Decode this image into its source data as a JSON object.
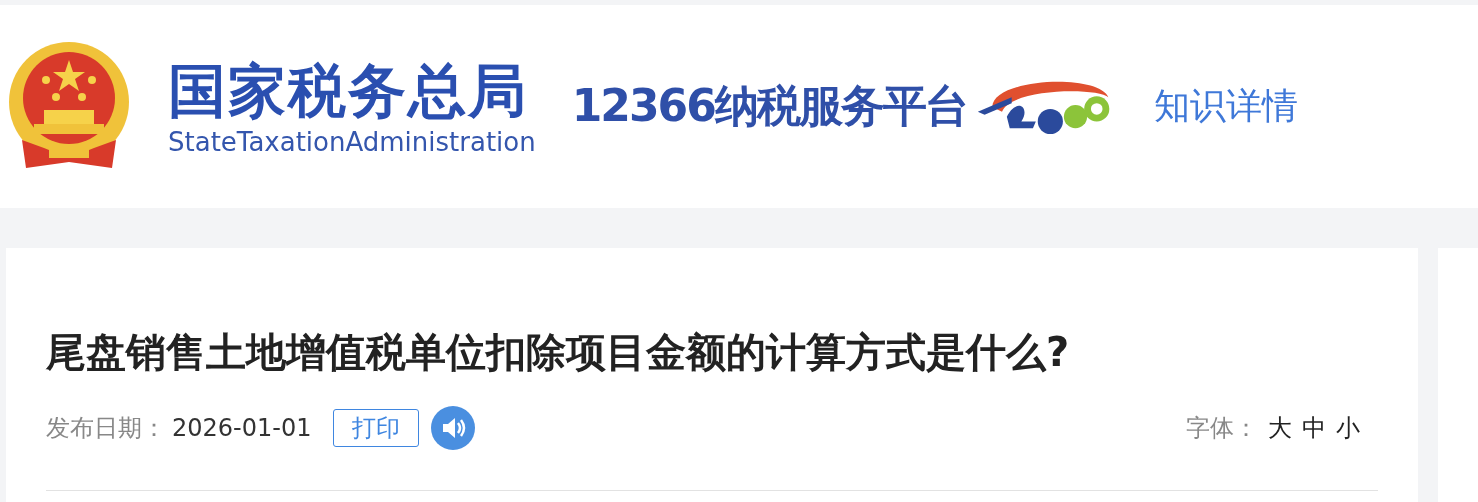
{
  "header": {
    "agency_name": "国家税务总局",
    "agency_name_en": "StateTaxationAdministration",
    "platform_name": "12366纳税服务平台",
    "section_link": "知识详情"
  },
  "article": {
    "title": "尾盘销售土地增值税单位扣除项目金额的计算方式是什么?",
    "date_label": "发布日期：",
    "date": "2026-01-01",
    "print_button": "打印",
    "font_label": "字体：",
    "font_sizes": [
      "大",
      "中",
      "小"
    ]
  }
}
